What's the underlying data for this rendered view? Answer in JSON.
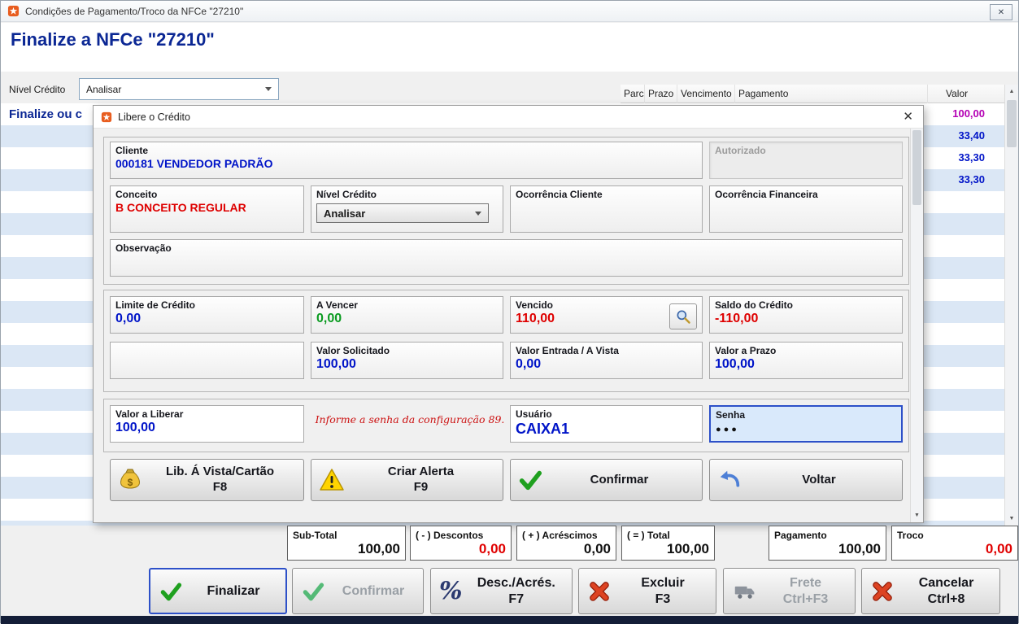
{
  "window": {
    "title": "Condições de Pagamento/Troco da NFCe \"27210\"",
    "close_glyph": "✕"
  },
  "header": {
    "title": "Finalize a NFCe \"27210\""
  },
  "toolbar": {
    "credit_level_label": "Nível Crédito",
    "credit_level_value": "Analisar"
  },
  "grid": {
    "columns": [
      "Parc",
      "Prazo",
      "Vencimento",
      "Pagamento",
      "Valor"
    ],
    "left_note": "Finalize ou c",
    "values": [
      {
        "valor": "100,00"
      },
      {
        "valor": "33,40"
      },
      {
        "valor": "33,30"
      },
      {
        "valor": "33,30"
      }
    ]
  },
  "dialog": {
    "title": "Libere o Crédito",
    "close_glyph": "✕",
    "cliente": {
      "label": "Cliente",
      "value": "000181    VENDEDOR PADRÃO"
    },
    "autorizado": {
      "label": "Autorizado"
    },
    "conceito": {
      "label": "Conceito",
      "value": "B   CONCEITO REGULAR"
    },
    "nivel_credito": {
      "label": "Nível Crédito",
      "value": "Analisar"
    },
    "ocorrencia_cliente": {
      "label": "Ocorrência Cliente"
    },
    "ocorrencia_financeira": {
      "label": "Ocorrência Financeira"
    },
    "observacao": {
      "label": "Observação"
    },
    "limite": {
      "label": "Limite de Crédito",
      "value": "0,00"
    },
    "a_vencer": {
      "label": "A Vencer",
      "value": "0,00"
    },
    "vencido": {
      "label": "Vencido",
      "value": "110,00"
    },
    "saldo": {
      "label": "Saldo do Crédito",
      "value": "-110,00"
    },
    "valor_solicitado": {
      "label": "Valor Solicitado",
      "value": "100,00"
    },
    "valor_entrada": {
      "label": "Valor Entrada / A Vista",
      "value": "0,00"
    },
    "valor_prazo": {
      "label": "Valor a Prazo",
      "value": "100,00"
    },
    "valor_liberar": {
      "label": "Valor a Liberar",
      "value": "100,00"
    },
    "hint": "Informe a senha da configuração 89.",
    "usuario": {
      "label": "Usuário",
      "value": "CAIXA1"
    },
    "senha": {
      "label": "Senha",
      "value": "●●●"
    },
    "buttons": {
      "lib_vista": {
        "label": "Lib. Á Vista/Cartão",
        "key": "F8"
      },
      "criar_alerta": {
        "label": "Criar Alerta",
        "key": "F9"
      },
      "confirmar": {
        "label": "Confirmar"
      },
      "voltar": {
        "label": "Voltar"
      }
    }
  },
  "totals": {
    "subtotal": {
      "label": "Sub-Total",
      "value": "100,00"
    },
    "descontos": {
      "label": "( - ) Descontos",
      "value": "0,00"
    },
    "acrescimos": {
      "label": "( + ) Acréscimos",
      "value": "0,00"
    },
    "total": {
      "label": "( = ) Total",
      "value": "100,00"
    },
    "pagamento": {
      "label": "Pagamento",
      "value": "100,00"
    },
    "troco": {
      "label": "Troco",
      "value": "0,00"
    }
  },
  "footer": {
    "finalizar": {
      "label": "Finalizar"
    },
    "confirmar": {
      "label": "Confirmar"
    },
    "desc_acres": {
      "label": "Desc./Acrés.",
      "key": "F7"
    },
    "excluir": {
      "label": "Excluir",
      "key": "F3"
    },
    "frete": {
      "label": "Frete",
      "key": "Ctrl+F3"
    },
    "cancelar": {
      "label": "Cancelar",
      "key": "Ctrl+8"
    }
  },
  "icons": {
    "percent_glyph": "%",
    "up_arrow": "▲",
    "down_arrow": "▼"
  },
  "colors": {
    "accent_navy": "#0b2794",
    "value_blue": "#0014c8",
    "value_red": "#de0000",
    "value_green": "#0a9b20",
    "value_magenta": "#b400b4",
    "row_alt": "#dbe7f5",
    "senha_focus": "#2d50c8",
    "bottom_strip": "#141e38"
  }
}
